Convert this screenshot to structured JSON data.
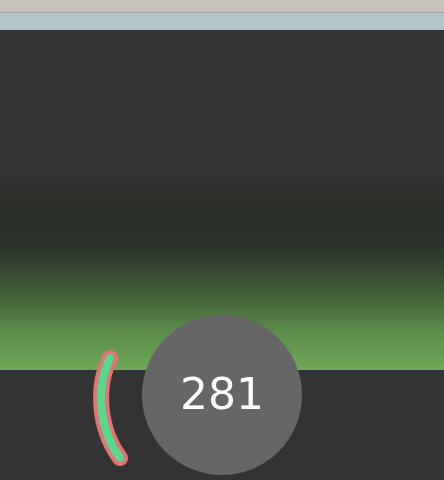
{
  "colors": {
    "background": "#333333",
    "top_strip": "#c8c0bb",
    "top_bar": "#b5c4c6",
    "ground_green": "#6fa957",
    "score_circle": "#666666",
    "gauge_border": "#e57373",
    "gauge_fill": "#55d98c"
  },
  "gauge": {
    "icon": "curved-level-gauge",
    "level": 1.0
  },
  "score": {
    "value": "281"
  }
}
